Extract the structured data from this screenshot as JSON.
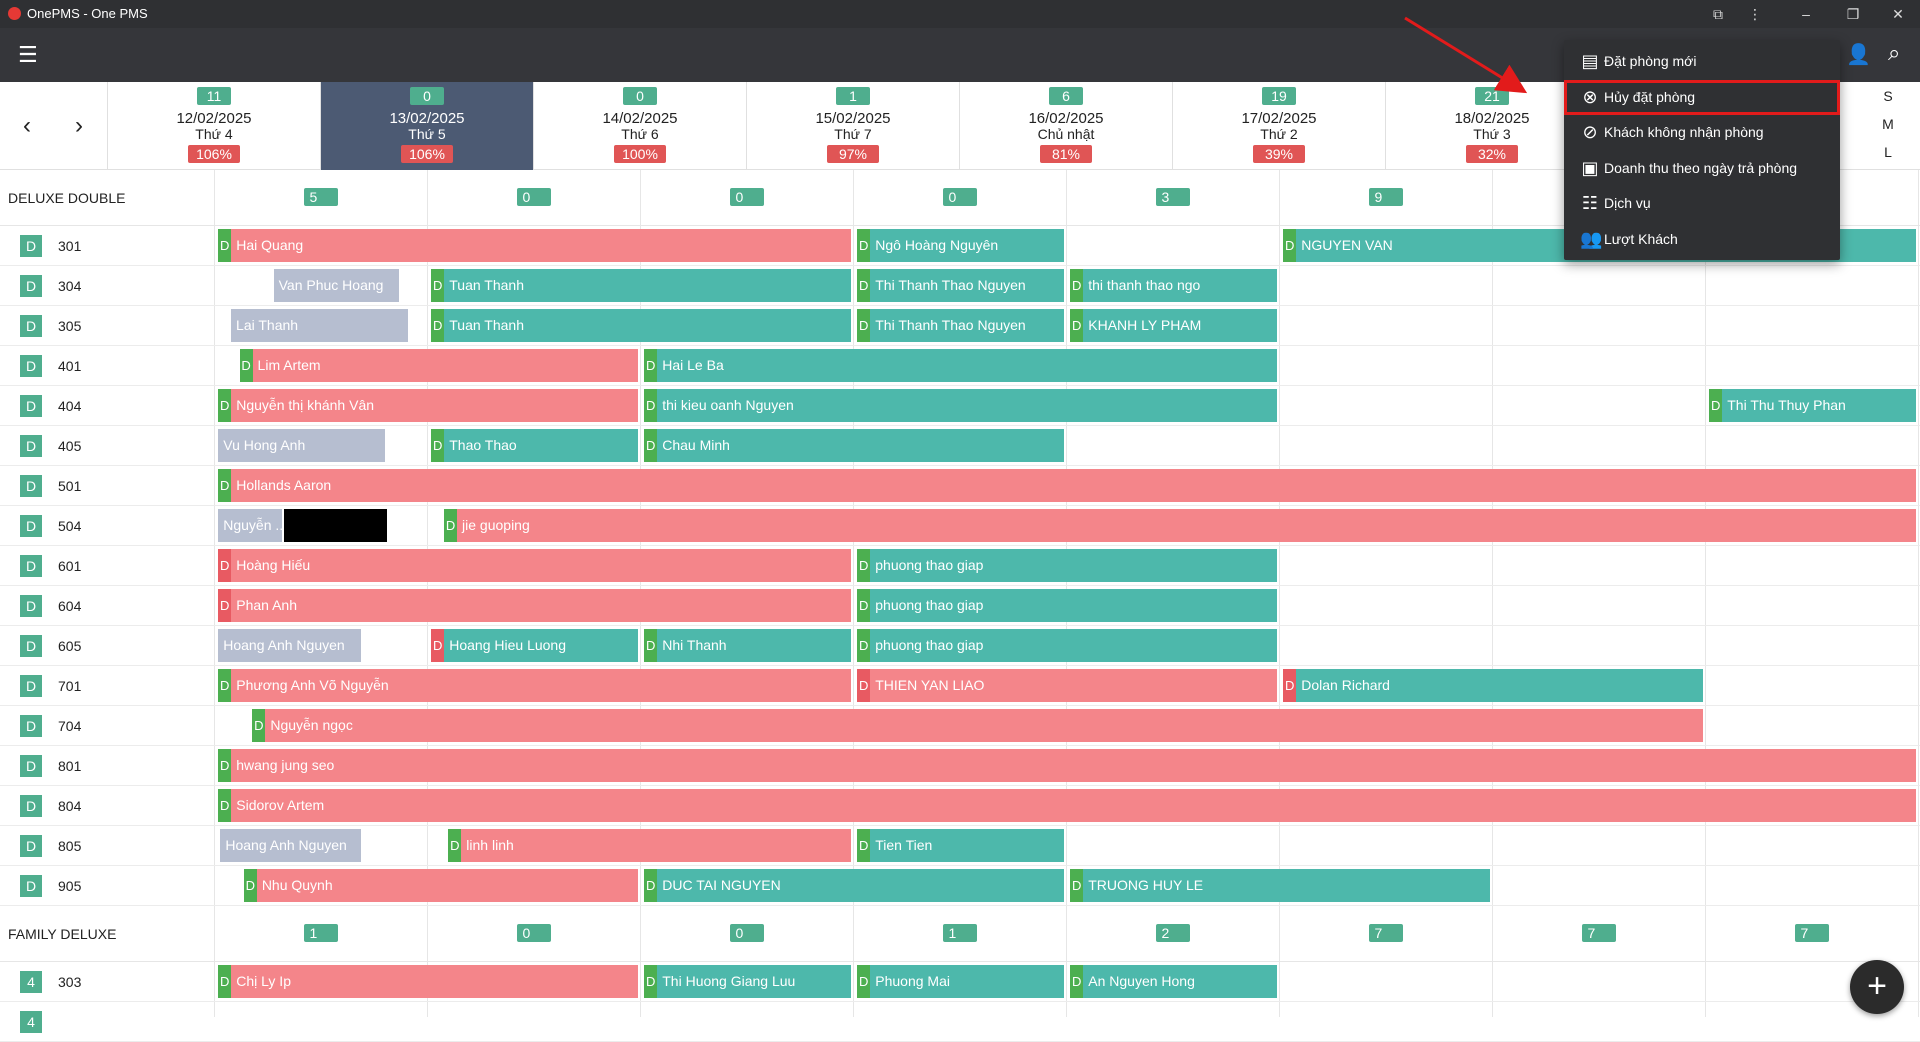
{
  "window": {
    "title": "OnePMS - One PMS",
    "min": "–",
    "max": "❐",
    "close": "✕"
  },
  "toolbar": {
    "menu_icon": "menu-icon",
    "add_guest_icon": "person-add-icon",
    "search_icon": "search-icon"
  },
  "nav": {
    "prev": "‹",
    "next": "›"
  },
  "dates": [
    {
      "count": "11",
      "date": "12/02/2025",
      "day": "Thứ 4",
      "occ": "106%",
      "selected": false
    },
    {
      "count": "0",
      "date": "13/02/2025",
      "day": "Thứ 5",
      "occ": "106%",
      "selected": true
    },
    {
      "count": "0",
      "date": "14/02/2025",
      "day": "Thứ 6",
      "occ": "100%",
      "selected": false
    },
    {
      "count": "1",
      "date": "15/02/2025",
      "day": "Thứ 7",
      "occ": "97%",
      "selected": false
    },
    {
      "count": "6",
      "date": "16/02/2025",
      "day": "Chủ nhật",
      "occ": "81%",
      "selected": false
    },
    {
      "count": "19",
      "date": "17/02/2025",
      "day": "Thứ 2",
      "occ": "39%",
      "selected": false
    },
    {
      "count": "21",
      "date": "18/02/2025",
      "day": "Thứ 3",
      "occ": "32%",
      "selected": false
    }
  ],
  "size_toggle": [
    "S",
    "M",
    "L"
  ],
  "groups": [
    {
      "name": "DELUXE DOUBLE",
      "counts": [
        "5",
        "0",
        "0",
        "0",
        "3",
        "9",
        "",
        ""
      ]
    },
    {
      "name": "FAMILY DELUXE",
      "counts": [
        "1",
        "0",
        "0",
        "1",
        "2",
        "7",
        "7",
        "7"
      ]
    }
  ],
  "rooms": [
    {
      "type": "D",
      "number": "301",
      "bookings": [
        {
          "name": "Hai Quang",
          "color": "red",
          "tag": "tg",
          "start": 0.02,
          "end": 3.0
        },
        {
          "name": "Ngô Hoàng Nguyên",
          "color": "teal",
          "tag": "tg",
          "start": 3.02,
          "end": 4.0
        },
        {
          "name": "NGUYEN VAN",
          "color": "teal",
          "tag": "tg",
          "start": 5.02,
          "end": 8.0
        }
      ]
    },
    {
      "type": "D",
      "number": "304",
      "bookings": [
        {
          "name": "Van Phuc Hoang",
          "color": "grey",
          "tag": "",
          "start": 0.28,
          "end": 0.88
        },
        {
          "name": "Tuan Thanh",
          "color": "teal",
          "tag": "tg",
          "start": 1.02,
          "end": 3.0
        },
        {
          "name": "Thi Thanh Thao Nguyen",
          "color": "teal",
          "tag": "tg",
          "start": 3.02,
          "end": 4.0
        },
        {
          "name": "thi thanh thao ngo",
          "color": "teal",
          "tag": "tg",
          "start": 4.02,
          "end": 5.0
        }
      ]
    },
    {
      "type": "D",
      "number": "305",
      "bookings": [
        {
          "name": "Lai Thanh",
          "color": "grey",
          "tag": "",
          "start": 0.08,
          "end": 0.92
        },
        {
          "name": "Tuan Thanh",
          "color": "teal",
          "tag": "tg",
          "start": 1.02,
          "end": 3.0
        },
        {
          "name": "Thi Thanh Thao Nguyen",
          "color": "teal",
          "tag": "tg",
          "start": 3.02,
          "end": 4.0
        },
        {
          "name": "KHANH LY PHAM",
          "color": "teal",
          "tag": "tg",
          "start": 4.02,
          "end": 5.0
        }
      ]
    },
    {
      "type": "D",
      "number": "401",
      "bookings": [
        {
          "name": "Lim Artem",
          "color": "red",
          "tag": "tg",
          "start": 0.12,
          "end": 2.0
        },
        {
          "name": "Hai Le Ba",
          "color": "teal",
          "tag": "tg",
          "start": 2.02,
          "end": 5.0
        }
      ]
    },
    {
      "type": "D",
      "number": "404",
      "bookings": [
        {
          "name": "Nguyễn thị khánh Vân",
          "color": "red",
          "tag": "tg",
          "start": 0.02,
          "end": 2.0
        },
        {
          "name": "thi kieu oanh Nguyen",
          "color": "teal",
          "tag": "tg",
          "start": 2.02,
          "end": 5.0
        },
        {
          "name": "Thi Thu Thuy Phan",
          "color": "teal",
          "tag": "tg",
          "start": 7.02,
          "end": 8.0
        }
      ]
    },
    {
      "type": "D",
      "number": "405",
      "bookings": [
        {
          "name": "Vu Hong Anh",
          "color": "grey",
          "tag": "",
          "start": 0.02,
          "end": 0.81
        },
        {
          "name": "Thao Thao",
          "color": "teal",
          "tag": "tg",
          "start": 1.02,
          "end": 2.0
        },
        {
          "name": "Chau Minh",
          "color": "teal",
          "tag": "tg",
          "start": 2.02,
          "end": 4.0
        }
      ]
    },
    {
      "type": "D",
      "number": "501",
      "bookings": [
        {
          "name": "Hollands Aaron",
          "color": "red",
          "tag": "tg",
          "start": 0.02,
          "end": 8.0
        }
      ]
    },
    {
      "type": "D",
      "number": "504",
      "bookings": [
        {
          "name": "Nguyễn ...",
          "color": "grey",
          "tag": "",
          "start": 0.02,
          "end": 0.33
        },
        {
          "name": "jie guoping",
          "color": "red",
          "tag": "tg",
          "start": 1.08,
          "end": 8.0
        }
      ]
    },
    {
      "type": "D",
      "number": "601",
      "bookings": [
        {
          "name": "Hoàng Hiếu",
          "color": "red",
          "tag": "tr",
          "start": 0.02,
          "end": 3.0
        },
        {
          "name": "phuong thao giap",
          "color": "teal",
          "tag": "tg",
          "start": 3.02,
          "end": 5.0
        }
      ]
    },
    {
      "type": "D",
      "number": "604",
      "bookings": [
        {
          "name": "Phan Anh",
          "color": "red",
          "tag": "tr",
          "start": 0.02,
          "end": 3.0
        },
        {
          "name": "phuong thao giap",
          "color": "teal",
          "tag": "tg",
          "start": 3.02,
          "end": 5.0
        }
      ]
    },
    {
      "type": "D",
      "number": "605",
      "bookings": [
        {
          "name": "Hoang Anh Nguyen",
          "color": "grey",
          "tag": "",
          "start": 0.02,
          "end": 0.7
        },
        {
          "name": "Hoang Hieu Luong",
          "color": "teal",
          "tag": "tr",
          "start": 1.02,
          "end": 2.0
        },
        {
          "name": "Nhi Thanh",
          "color": "teal",
          "tag": "tg",
          "start": 2.02,
          "end": 3.0
        },
        {
          "name": "phuong thao giap",
          "color": "teal",
          "tag": "tg",
          "start": 3.02,
          "end": 5.0
        }
      ]
    },
    {
      "type": "D",
      "number": "701",
      "bookings": [
        {
          "name": "Phương Anh Võ Nguyễn",
          "color": "red",
          "tag": "tg",
          "start": 0.02,
          "end": 3.0
        },
        {
          "name": "THIEN YAN LIAO",
          "color": "red",
          "tag": "tr",
          "start": 3.02,
          "end": 5.0
        },
        {
          "name": "Dolan Richard",
          "color": "teal",
          "tag": "tr",
          "start": 5.02,
          "end": 7.0
        }
      ]
    },
    {
      "type": "D",
      "number": "704",
      "bookings": [
        {
          "name": "Nguyễn ngọc",
          "color": "red",
          "tag": "tg",
          "start": 0.18,
          "end": 7.0
        }
      ]
    },
    {
      "type": "D",
      "number": "801",
      "bookings": [
        {
          "name": "hwang jung seo",
          "color": "red",
          "tag": "tg",
          "start": 0.02,
          "end": 8.0
        }
      ]
    },
    {
      "type": "D",
      "number": "804",
      "bookings": [
        {
          "name": "Sidorov Artem",
          "color": "red",
          "tag": "tg",
          "start": 0.02,
          "end": 8.0
        }
      ]
    },
    {
      "type": "D",
      "number": "805",
      "bookings": [
        {
          "name": "Hoang Anh Nguyen",
          "color": "grey",
          "tag": "",
          "start": 0.03,
          "end": 0.7
        },
        {
          "name": "linh linh",
          "color": "red",
          "tag": "tg",
          "start": 1.1,
          "end": 3.0
        },
        {
          "name": "Tien Tien",
          "color": "teal",
          "tag": "tg",
          "start": 3.02,
          "end": 4.0
        }
      ]
    },
    {
      "type": "D",
      "number": "905",
      "bookings": [
        {
          "name": "Nhu Quynh",
          "color": "red",
          "tag": "tg",
          "start": 0.14,
          "end": 2.0
        },
        {
          "name": "DUC TAI NGUYEN",
          "color": "teal",
          "tag": "tg",
          "start": 2.02,
          "end": 4.0
        },
        {
          "name": "TRUONG HUY LE",
          "color": "teal",
          "tag": "tg",
          "start": 4.02,
          "end": 6.0
        }
      ]
    }
  ],
  "family_rooms": [
    {
      "type": "4",
      "number": "303",
      "bookings": [
        {
          "name": "Chị Ly Ip",
          "color": "red",
          "tag": "tg",
          "start": 0.02,
          "end": 2.0
        },
        {
          "name": "Thi Huong Giang Luu",
          "color": "teal",
          "tag": "tg",
          "start": 2.02,
          "end": 3.0
        },
        {
          "name": "Phuong Mai",
          "color": "teal",
          "tag": "tg",
          "start": 3.02,
          "end": 4.0
        },
        {
          "name": "An Nguyen Hong",
          "color": "teal",
          "tag": "tg",
          "start": 4.02,
          "end": 5.0
        }
      ]
    }
  ],
  "menu": {
    "items": [
      {
        "label": "Đặt phòng mới",
        "icon": "booking-list-icon",
        "glyph": "▤"
      },
      {
        "label": "Hủy đặt phòng",
        "icon": "cancel-circle-icon",
        "glyph": "⊗"
      },
      {
        "label": "Khách không nhận phòng",
        "icon": "no-show-icon",
        "glyph": "⊘"
      },
      {
        "label": "Doanh thu theo ngày trả phòng",
        "icon": "revenue-icon",
        "glyph": "▣"
      },
      {
        "label": "Dịch vụ",
        "icon": "service-icon",
        "glyph": "☷"
      },
      {
        "label": "Lượt Khách",
        "icon": "guests-icon",
        "glyph": "👥"
      }
    ],
    "highlighted": 1
  },
  "fab": {
    "label": "+"
  }
}
